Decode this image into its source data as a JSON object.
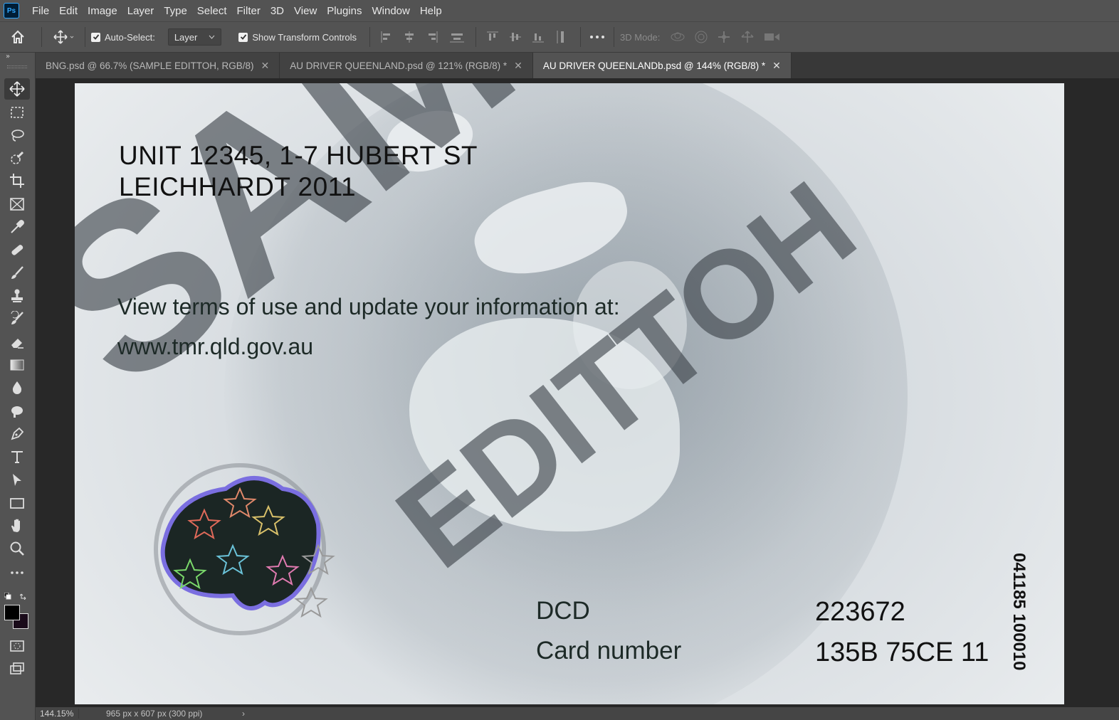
{
  "app": {
    "logo": "Ps",
    "menu": [
      "File",
      "Edit",
      "Image",
      "Layer",
      "Type",
      "Select",
      "Filter",
      "3D",
      "View",
      "Plugins",
      "Window",
      "Help"
    ]
  },
  "options": {
    "auto_select_label": "Auto-Select:",
    "auto_select_checked": true,
    "layer_dropdown": "Layer",
    "show_transform_label": "Show Transform Controls",
    "show_transform_checked": true,
    "mode_3d_label": "3D Mode:"
  },
  "tabs": [
    {
      "label": "BNG.psd @ 66.7% (SAMPLE   EDITTOH, RGB/8)",
      "active": false
    },
    {
      "label": "AU DRIVER QUEENLAND.psd @ 121% (RGB/8) *",
      "active": false
    },
    {
      "label": "AU DRIVER QUEENLANDb.psd @ 144% (RGB/8) *",
      "active": true
    }
  ],
  "tools": [
    "move-tool",
    "marquee-tool",
    "lasso-tool",
    "quick-select-tool",
    "crop-tool",
    "frame-tool",
    "eyedropper-tool",
    "healing-tool",
    "brush-tool",
    "stamp-tool",
    "history-brush-tool",
    "eraser-tool",
    "gradient-tool",
    "blur-tool",
    "dodge-tool",
    "pen-tool",
    "type-tool",
    "path-select-tool",
    "rectangle-tool",
    "hand-tool",
    "zoom-tool",
    "more-tools"
  ],
  "card": {
    "address_line1": "UNIT 12345, 1-7 HUBERT ST",
    "address_line2": "LEICHHARDT 2011",
    "terms": "View terms of use and update your information at:",
    "url": "www.tmr.qld.gov.au",
    "watermark_1": "SAMPLE",
    "watermark_2": "EDITTOH",
    "dcd_label": "DCD",
    "dcd_value": "223672",
    "card_number_label": "Card number",
    "card_number_value": "135B 75CE 11",
    "side_number": "041185 100010"
  },
  "status": {
    "zoom": "144.15%",
    "doc_info": "965 px x 607 px (300 ppi)",
    "arrow": "›"
  },
  "colors": {
    "ui_panel": "#535353",
    "ui_dark": "#282828",
    "tab_active": "#535353",
    "ps_blue": "#31a8ff"
  }
}
